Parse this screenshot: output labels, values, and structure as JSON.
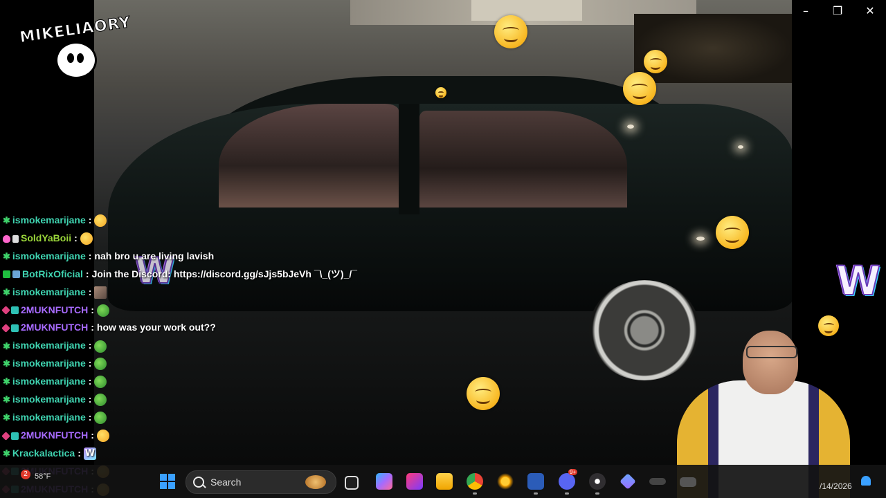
{
  "logo": {
    "text": "MIKELIAORY"
  },
  "window_controls": {
    "minimize": "–",
    "maximize": "❐",
    "close": "✕"
  },
  "chat": {
    "messages": [
      {
        "user": "ismokemarijane",
        "user_color": "#3fd3b0",
        "badges": [
          "leaf"
        ],
        "text": "",
        "emote": "pink"
      },
      {
        "user": "SoldYaBoii",
        "user_color": "#9ad63a",
        "badges": [
          "heart",
          "one"
        ],
        "text": "",
        "emote": "smile"
      },
      {
        "user": "ismokemarijane",
        "user_color": "#3fd3b0",
        "badges": [
          "leaf"
        ],
        "text": "nah bro u are living lavish",
        "emote": ""
      },
      {
        "user": "BotRixOficial",
        "user_color": "#3fd3b0",
        "badges": [
          "green",
          "bot"
        ],
        "text": "Join the Discord: https://discord.gg/sJjs5bJeVh ¯\\_(ツ)_/¯",
        "emote": ""
      },
      {
        "user": "ismokemarijane",
        "user_color": "#3fd3b0",
        "badges": [
          "leaf"
        ],
        "text": "",
        "emote": "pic"
      },
      {
        "user": "2MUKNFUTCH",
        "user_color": "#a86bff",
        "badges": [
          "gem",
          "tier"
        ],
        "text": "",
        "emote": "pepe"
      },
      {
        "user": "2MUKNFUTCH",
        "user_color": "#a86bff",
        "badges": [
          "gem",
          "tier"
        ],
        "text": "how was your work out??",
        "emote": ""
      },
      {
        "user": "ismokemarijane",
        "user_color": "#3fd3b0",
        "badges": [
          "leaf"
        ],
        "text": "",
        "emote": "pepe"
      },
      {
        "user": "ismokemarijane",
        "user_color": "#3fd3b0",
        "badges": [
          "leaf"
        ],
        "text": "",
        "emote": "pepe"
      },
      {
        "user": "ismokemarijane",
        "user_color": "#3fd3b0",
        "badges": [
          "leaf"
        ],
        "text": "",
        "emote": "pepe"
      },
      {
        "user": "ismokemarijane",
        "user_color": "#3fd3b0",
        "badges": [
          "leaf"
        ],
        "text": "",
        "emote": "pepe"
      },
      {
        "user": "ismokemarijane",
        "user_color": "#3fd3b0",
        "badges": [
          "leaf"
        ],
        "text": "",
        "emote": "pepe"
      },
      {
        "user": "2MUKNFUTCH",
        "user_color": "#a86bff",
        "badges": [
          "gem",
          "tier"
        ],
        "text": "",
        "emote": "smile"
      },
      {
        "user": "Krackalactica",
        "user_color": "#3fd3b0",
        "badges": [
          "leaf"
        ],
        "text": "",
        "emote": "w"
      },
      {
        "user": "2MUKNFUTCH",
        "user_color": "#a86bff",
        "badges": [
          "gem",
          "tier"
        ],
        "text": "",
        "emote": "smile"
      },
      {
        "user": "2MUKNFUTCH",
        "user_color": "#a86bff",
        "badges": [
          "gem",
          "tier"
        ],
        "text": "",
        "emote": "smile"
      }
    ]
  },
  "overlay": {
    "w_emote_text": "W"
  },
  "taskbar": {
    "weather_temp": "58°F",
    "weather_alert_count": "2",
    "search_label": "Search",
    "notifications_badge": "9+",
    "app_icons": [
      "task-view",
      "copilot",
      "photos",
      "file-explorer",
      "chrome",
      "brightness",
      "word",
      "discord",
      "obs",
      "vpn",
      "keyboard",
      "cloud"
    ],
    "date": "/14/2026"
  },
  "colors": {
    "username_green": "#3fd3b0",
    "username_purple": "#a86bff",
    "taskbar_bg": "#121212",
    "accent": "#3aa0ff"
  }
}
